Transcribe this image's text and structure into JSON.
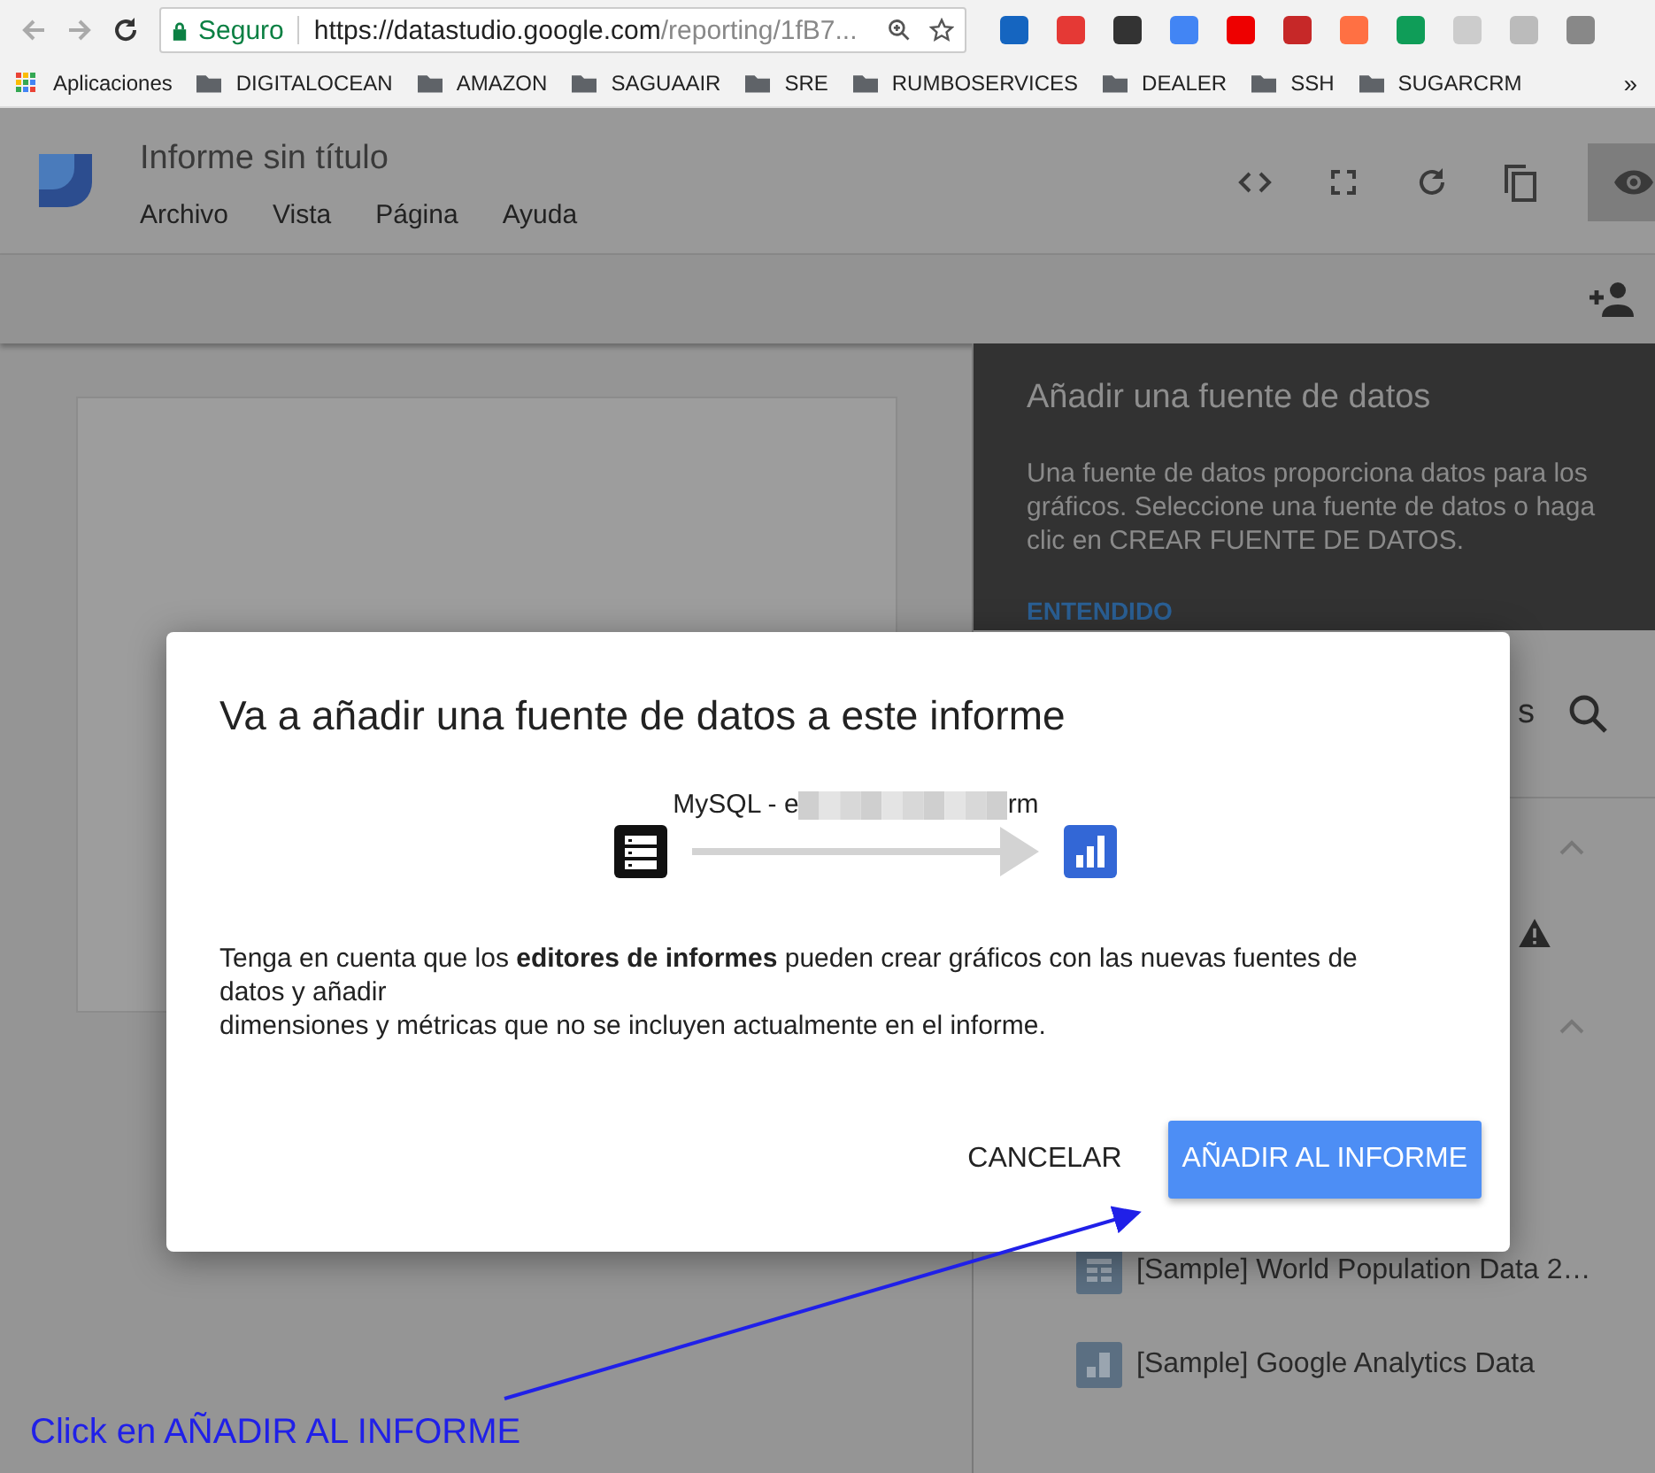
{
  "browser": {
    "security_label": "Seguro",
    "url_host": "https://datastudio.google.com",
    "url_path": "/reporting/1fB7...",
    "more": "»",
    "bookmarks": [
      {
        "label": "Aplicaciones",
        "kind": "apps"
      },
      {
        "label": "DIGITALOCEAN",
        "kind": "folder"
      },
      {
        "label": "AMAZON",
        "kind": "folder"
      },
      {
        "label": "SAGUAAIR",
        "kind": "folder"
      },
      {
        "label": "SRE",
        "kind": "folder"
      },
      {
        "label": "RUMBOSERVICES",
        "kind": "folder"
      },
      {
        "label": "DEALER",
        "kind": "folder"
      },
      {
        "label": "SSH",
        "kind": "folder"
      },
      {
        "label": "SUGARCRM",
        "kind": "folder"
      }
    ]
  },
  "app": {
    "title": "Informe sin título",
    "menu": [
      "Archivo",
      "Vista",
      "Página",
      "Ayuda"
    ]
  },
  "tooltip": {
    "title": "Añadir una fuente de datos",
    "body": "Una fuente de datos proporciona datos para los gráficos. Seleccione una fuente de datos o haga clic en CREAR FUENTE DE DATOS.",
    "action": "ENTENDIDO"
  },
  "panel": {
    "heading_fragment": "s",
    "items": [
      {
        "label": "[Sample] World Population Data 2…",
        "kind": "table"
      },
      {
        "label": "[Sample] Google Analytics Data",
        "kind": "chart"
      }
    ]
  },
  "dialog": {
    "title": "Va a añadir una fuente de datos a este informe",
    "source_prefix": "MySQL - e",
    "source_suffix": "rm",
    "note": "Tenga en cuenta que los **editores de informes** pueden crear gráficos con las nuevas fuentes de datos y añadir\ndimensiones y métricas que no se incluyen actualmente en el informe.",
    "buttons": [
      {
        "label": "CANCELAR",
        "kind": "text"
      },
      {
        "label": "AÑADIR AL INFORME",
        "kind": "primary"
      }
    ]
  },
  "annotation": "Click en AÑADIR AL INFORME"
}
